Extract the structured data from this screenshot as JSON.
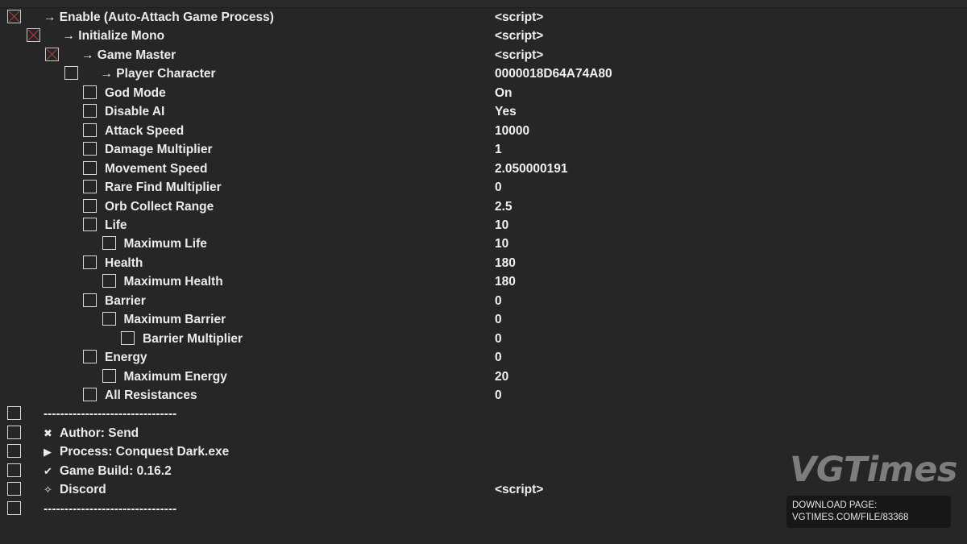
{
  "rows": [
    {
      "description": "→ Enable (Auto-Attach Game Process)",
      "value": "<script>",
      "checked": true
    },
    {
      "description": "→ Initialize Mono",
      "value": "<script>",
      "checked": true
    },
    {
      "description": "→ Game Master",
      "value": "<script>",
      "checked": true
    },
    {
      "description": "→ Player Character",
      "value": "0000018D64A74A80",
      "checked": false
    },
    {
      "description": "God Mode",
      "value": "On",
      "checked": false
    },
    {
      "description": "Disable AI",
      "value": "Yes",
      "checked": false
    },
    {
      "description": "Attack Speed",
      "value": "10000",
      "checked": false
    },
    {
      "description": "Damage Multiplier",
      "value": "1",
      "checked": false
    },
    {
      "description": "Movement Speed",
      "value": "2.050000191",
      "checked": false
    },
    {
      "description": "Rare Find Multiplier",
      "value": "0",
      "checked": false
    },
    {
      "description": "Orb Collect Range",
      "value": "2.5",
      "checked": false
    },
    {
      "description": "Life",
      "value": "10",
      "checked": false
    },
    {
      "description": "Maximum Life",
      "value": "10",
      "checked": false
    },
    {
      "description": "Health",
      "value": "180",
      "checked": false
    },
    {
      "description": "Maximum Health",
      "value": "180",
      "checked": false
    },
    {
      "description": "Barrier",
      "value": "0",
      "checked": false
    },
    {
      "description": "Maximum Barrier",
      "value": "0",
      "checked": false
    },
    {
      "description": "Barrier Multiplier",
      "value": "0",
      "checked": false
    },
    {
      "description": "Energy",
      "value": "0",
      "checked": false
    },
    {
      "description": "Maximum Energy",
      "value": "20",
      "checked": false
    },
    {
      "description": "All Resistances",
      "value": "0",
      "checked": false
    },
    {
      "description": "--------------------------------",
      "value": "",
      "checked": false
    },
    {
      "description": "Author:  Send",
      "value": "",
      "checked": false,
      "icon": "crossed-swords-icon",
      "glyph": "✖"
    },
    {
      "description": "Process:  Conquest Dark.exe",
      "value": "",
      "checked": false,
      "icon": "play-triangle-icon",
      "glyph": "▶"
    },
    {
      "description": "Game Build: 0.16.2",
      "value": "",
      "checked": false,
      "icon": "check-mark-icon",
      "glyph": "✔"
    },
    {
      "description": "Discord",
      "value": "<script>",
      "checked": false,
      "icon": "discord-icon",
      "glyph": "✧"
    },
    {
      "description": "--------------------------------",
      "value": "",
      "checked": false
    }
  ],
  "watermark": {
    "brand": "VGTimes",
    "download_label": "DOWNLOAD PAGE:",
    "download_url": "VGTIMES.COM/FILE/83368"
  },
  "colors": {
    "background": "#262626",
    "text": "#ebebeb",
    "checkbox_border": "#d8d8d8",
    "check_mark": "#b23a3a"
  }
}
